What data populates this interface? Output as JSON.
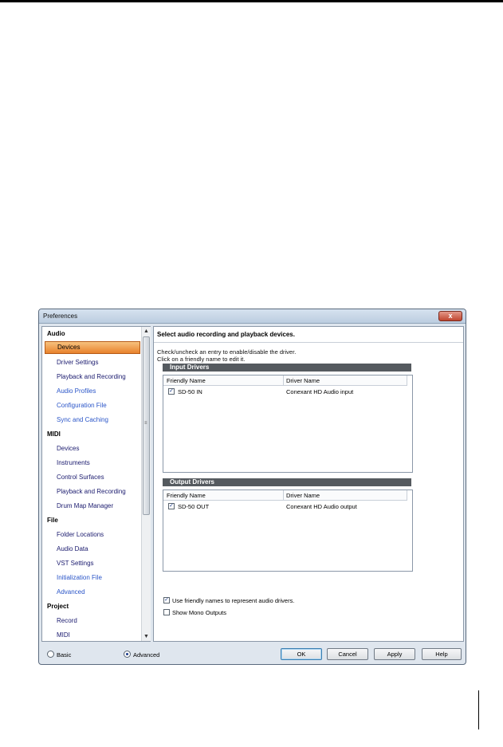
{
  "window": {
    "title": "Preferences",
    "close_glyph": "x"
  },
  "nav": {
    "scroll_up_glyph": "▲",
    "scroll_down_glyph": "▼",
    "scroll_grip": "≡",
    "items": [
      {
        "label": "Audio",
        "type": "category"
      },
      {
        "label": "Devices",
        "type": "item",
        "selected": true
      },
      {
        "label": "Driver Settings",
        "type": "item"
      },
      {
        "label": "Playback and Recording",
        "type": "item"
      },
      {
        "label": "Audio Profiles",
        "type": "item"
      },
      {
        "label": "Configuration File",
        "type": "item"
      },
      {
        "label": "Sync and Caching",
        "type": "item"
      },
      {
        "label": "MIDI",
        "type": "category"
      },
      {
        "label": "Devices",
        "type": "item"
      },
      {
        "label": "Instruments",
        "type": "item"
      },
      {
        "label": "Control Surfaces",
        "type": "item"
      },
      {
        "label": "Playback and Recording",
        "type": "item"
      },
      {
        "label": "Drum Map Manager",
        "type": "item"
      },
      {
        "label": "File",
        "type": "category"
      },
      {
        "label": "Folder Locations",
        "type": "item"
      },
      {
        "label": "Audio Data",
        "type": "item"
      },
      {
        "label": "VST Settings",
        "type": "item"
      },
      {
        "label": "Initialization File",
        "type": "item"
      },
      {
        "label": "Advanced",
        "type": "item"
      },
      {
        "label": "Project",
        "type": "category"
      },
      {
        "label": "Record",
        "type": "item"
      },
      {
        "label": "MIDI",
        "type": "item"
      }
    ]
  },
  "content": {
    "header": "Select audio recording and playback devices.",
    "instruction_line1": "Check/uncheck an entry to enable/disable the driver.",
    "instruction_line2": "Click on a friendly name to edit it.",
    "input_drivers": {
      "title": "Input Drivers",
      "col_friendly": "Friendly Name",
      "col_driver": "Driver Name",
      "rows": [
        {
          "friendly": "SD-50 IN",
          "driver": "Conexant HD Audio input",
          "checked": true
        }
      ]
    },
    "output_drivers": {
      "title": "Output Drivers",
      "col_friendly": "Friendly Name",
      "col_driver": "Driver Name",
      "rows": [
        {
          "friendly": "SD-50 OUT",
          "driver": "Conexant HD Audio output",
          "checked": true
        }
      ]
    },
    "use_friendly_names": {
      "label": "Use friendly names to represent audio drivers.",
      "checked": true
    },
    "show_mono_outputs": {
      "label": "Show Mono Outputs",
      "checked": false
    }
  },
  "footer": {
    "mode_basic": "Basic",
    "mode_advanced": "Advanced",
    "selected_mode": "Advanced",
    "ok": "OK",
    "cancel": "Cancel",
    "apply": "Apply",
    "help": "Help"
  },
  "check_glyph": "✓"
}
